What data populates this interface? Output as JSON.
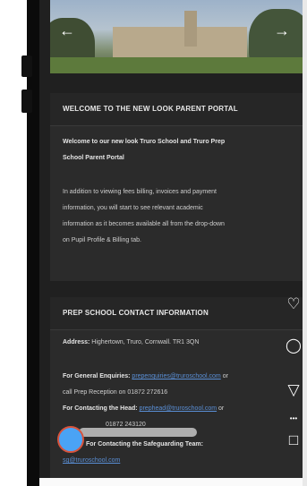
{
  "hero": {
    "left_arrow": "←",
    "right_arrow": "→"
  },
  "welcome": {
    "title": "WELCOME TO THE NEW LOOK PARENT PORTAL",
    "line1": "Welcome to our new look Truro School and Truro Prep",
    "line2": "School Parent Portal",
    "p1": "In addition to viewing fees billing, invoices and payment",
    "p2": "information, you will start to see relevant academic",
    "p3": "information as it becomes available all from the drop-down",
    "p4": "on Pupil Profile & Billing tab."
  },
  "prep": {
    "title": "PREP SCHOOL CONTACT INFORMATION",
    "address_label": "Address:",
    "address": "Highertown, Truro, Cornwall. TR1 3QN",
    "general_label": "For General Enquiries:",
    "general_email": "prepenquiries@truroschool.com",
    "general_tail": "or",
    "reception": "call Prep Reception on 01872 272616",
    "head_label": "For Contacting the Head:",
    "head_email": "prephead@truroschool.com",
    "head_tail": "or",
    "head_phone": "01872 243120",
    "safeguard_label": "For Contacting the Safeguarding Team:",
    "safeguard_email": "sg@truroschool.com"
  },
  "actions": {
    "heart": "♡",
    "comment": "◯",
    "filter": "▽",
    "more": "•••",
    "square": "□"
  }
}
